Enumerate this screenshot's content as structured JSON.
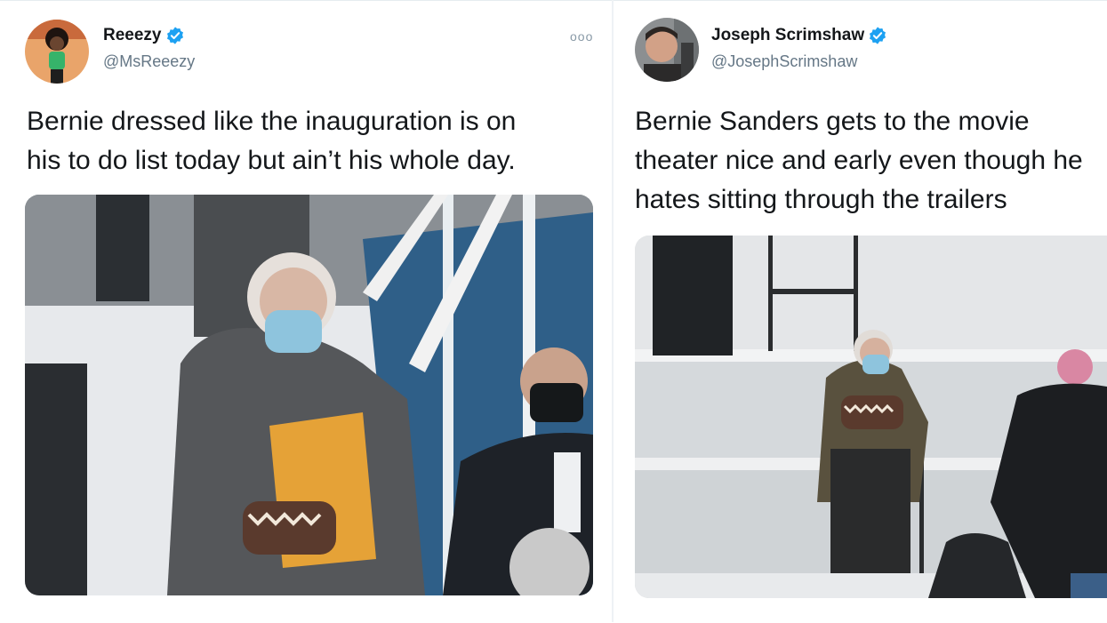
{
  "tweets": [
    {
      "name": "Reeezy",
      "handle": "@MsReeezy",
      "text_lines": [
        "Bernie dressed like the inauguration is on",
        "his to do list today but ain’t his whole day."
      ],
      "more_label": "ooo"
    },
    {
      "name": "Joseph Scrimshaw",
      "handle": "@JosephScrimshaw",
      "text_lines": [
        "Bernie Sanders gets to the movie",
        "theater nice and early even though he",
        "hates sitting through the trailers"
      ]
    }
  ],
  "colors": {
    "verified": "#1da1f2",
    "text": "#14171a",
    "handle": "#657786"
  },
  "icons": [
    "verified-badge-icon",
    "more-options-icon"
  ]
}
